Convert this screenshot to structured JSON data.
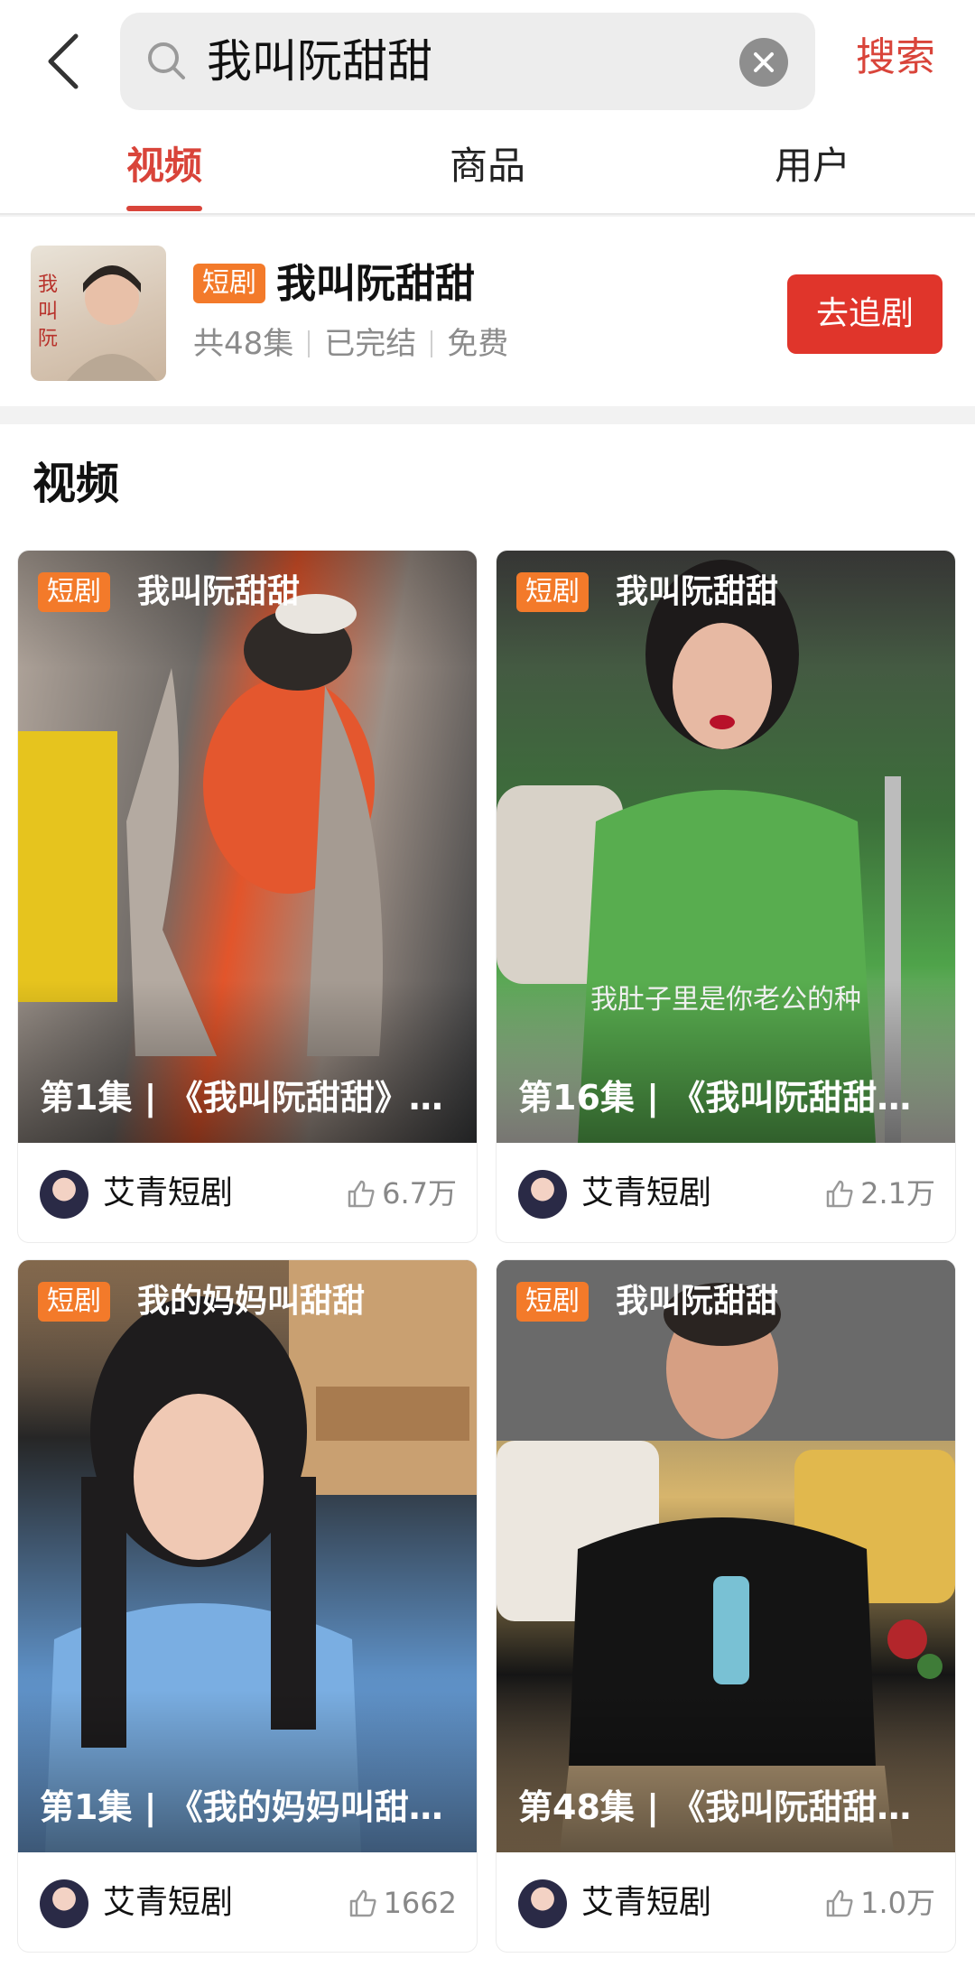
{
  "search": {
    "query": "我叫阮甜甜",
    "submit_label": "搜索"
  },
  "tabs": [
    {
      "label": "视频",
      "active": true
    },
    {
      "label": "商品",
      "active": false
    },
    {
      "label": "用户",
      "active": false
    }
  ],
  "drama": {
    "badge": "短剧",
    "title": "我叫阮甜甜",
    "episodes": "共48集",
    "status": "已完结",
    "price": "免费",
    "follow_label": "去追剧",
    "cover_text": "我叫阮甜甜"
  },
  "section": {
    "title": "视频"
  },
  "videos": [
    {
      "badge": "短剧",
      "tag_title": "我叫阮甜甜",
      "subtitle": "",
      "title": "第1集 | 《我叫阮甜甜》第…",
      "author": "艾青短剧",
      "likes": "6.7万"
    },
    {
      "badge": "短剧",
      "tag_title": "我叫阮甜甜",
      "subtitle": "我肚子里是你老公的种",
      "title": "第16集 | 《我叫阮甜甜》…",
      "author": "艾青短剧",
      "likes": "2.1万"
    },
    {
      "badge": "短剧",
      "tag_title": "我的妈妈叫甜甜",
      "subtitle": "",
      "title": "第1集 | 《我的妈妈叫甜…",
      "author": "艾青短剧",
      "likes": "1662"
    },
    {
      "badge": "短剧",
      "tag_title": "我叫阮甜甜",
      "subtitle": "",
      "title": "第48集 | 《我叫阮甜甜》…",
      "author": "艾青短剧",
      "likes": "1.0万"
    }
  ],
  "colors": {
    "accent": "#d9443a",
    "badge": "#f37a2a",
    "button": "#e0352b"
  },
  "icons": [
    "back-arrow-icon",
    "search-icon",
    "clear-icon",
    "thumbs-up-icon"
  ]
}
